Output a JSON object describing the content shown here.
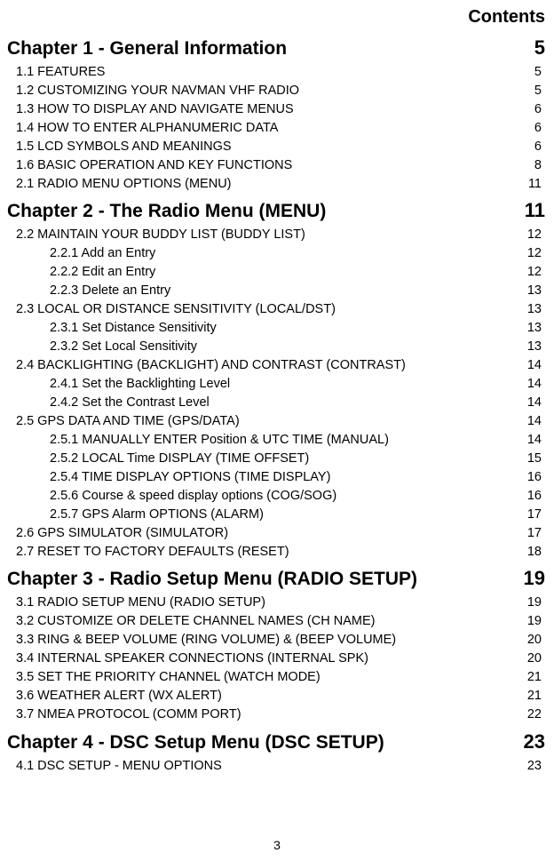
{
  "header": {
    "title": "Contents"
  },
  "page_number": "3",
  "chapters": [
    {
      "title": "Chapter 1 - General Information",
      "page": "5",
      "entries": [
        {
          "label": "1.1 FEATURES",
          "page": "5"
        },
        {
          "label": "1.2 CUSTOMIZING YOUR NAVMAN VHF RADIO",
          "page": "5"
        },
        {
          "label": "1.3 HOW TO DISPLAY AND NAVIGATE MENUS",
          "page": "6"
        },
        {
          "label": "1.4 HOW TO ENTER ALPHANUMERIC DATA",
          "page": "6"
        },
        {
          "label": "1.5 LCD SYMBOLS AND MEANINGS",
          "page": "6"
        },
        {
          "label": "1.6 BASIC OPERATION AND KEY FUNCTIONS",
          "page": "8"
        },
        {
          "label": "2.1 RADIO MENU OPTIONS (MENU)",
          "page": "11"
        }
      ]
    },
    {
      "title": "Chapter 2 - The Radio Menu (MENU)",
      "page": "11",
      "entries": [
        {
          "label": "2.2 MAINTAIN YOUR BUDDY LIST (BUDDY LIST)",
          "page": "12"
        },
        {
          "label": "2.2.1 Add an Entry",
          "page": "12",
          "sub": true
        },
        {
          "label": "2.2.2 Edit an Entry",
          "page": "12",
          "sub": true
        },
        {
          "label": "2.2.3 Delete an Entry",
          "page": "13",
          "sub": true
        },
        {
          "label": "2.3 LOCAL OR DISTANCE SENSITIVITY (LOCAL/DST)",
          "page": "13"
        },
        {
          "label": "2.3.1 Set Distance Sensitivity",
          "page": "13",
          "sub": true
        },
        {
          "label": "2.3.2 Set Local Sensitivity",
          "page": "13",
          "sub": true
        },
        {
          "label": "2.4 BACKLIGHTING (BACKLIGHT) AND CONTRAST (CONTRAST)",
          "page": "14"
        },
        {
          "label": "2.4.1 Set the Backlighting Level",
          "page": "14",
          "sub": true
        },
        {
          "label": "2.4.2 Set the Contrast Level",
          "page": "14",
          "sub": true
        },
        {
          "label": "2.5 GPS DATA AND TIME (GPS/DATA)",
          "page": "14"
        },
        {
          "label": "2.5.1 MANUALLY ENTER Position & UTC TIME (MANUAL)",
          "page": "14",
          "sub": true
        },
        {
          "label": "2.5.2 LOCAL Time DISPLAY (TIME OFFSET)",
          "page": "15",
          "sub": true
        },
        {
          "label": "2.5.4 TIME DISPLAY OPTIONS (TIME DISPLAY)",
          "page": "16",
          "sub": true
        },
        {
          "label": "2.5.6 Course & speed display options (COG/SOG)",
          "page": "16",
          "sub": true
        },
        {
          "label": "2.5.7 GPS Alarm OPTIONS (ALARM)",
          "page": "17",
          "sub": true
        },
        {
          "label": "2.6 GPS SIMULATOR (SIMULATOR)",
          "page": "17"
        },
        {
          "label": "2.7 RESET TO FACTORY DEFAULTS (RESET)",
          "page": "18"
        }
      ]
    },
    {
      "title": "Chapter 3 - Radio Setup Menu (RADIO SETUP)",
      "page": "19",
      "entries": [
        {
          "label": "3.1 RADIO SETUP MENU (RADIO SETUP)",
          "page": "19"
        },
        {
          "label": "3.2 CUSTOMIZE OR DELETE CHANNEL NAMES (CH NAME)",
          "page": "19"
        },
        {
          "label": "3.3 RING & BEEP VOLUME  (RING VOLUME) & (BEEP VOLUME)",
          "page": "20"
        },
        {
          "label": "3.4 INTERNAL SPEAKER CONNECTIONS (INTERNAL SPK)",
          "page": "20"
        },
        {
          "label": "3.5 SET THE PRIORITY CHANNEL (WATCH MODE)",
          "page": "21"
        },
        {
          "label": "3.6 WEATHER ALERT (WX ALERT)",
          "page": "21"
        },
        {
          "label": "3.7 NMEA PROTOCOL (COMM PORT)",
          "page": "22"
        }
      ]
    },
    {
      "title": "Chapter 4 - DSC Setup Menu (DSC SETUP)",
      "page": "23",
      "entries": [
        {
          "label": "4.1 DSC SETUP - MENU OPTIONS",
          "page": "23"
        }
      ]
    }
  ]
}
